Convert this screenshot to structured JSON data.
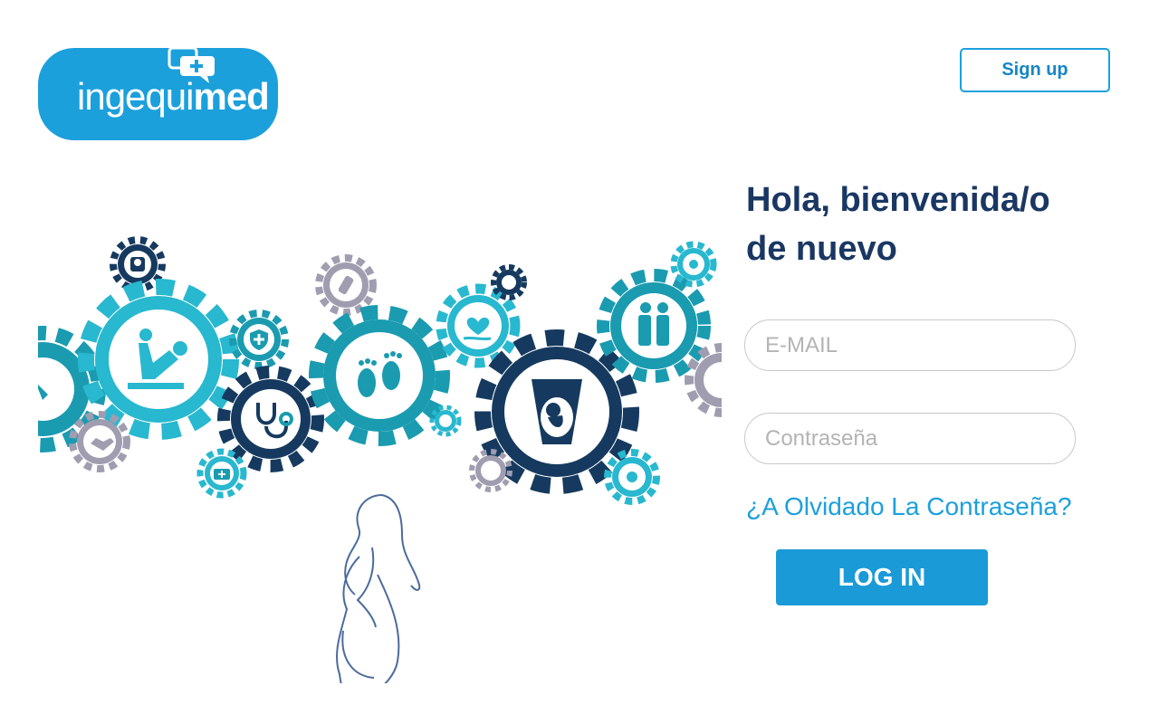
{
  "brand": {
    "logo_light": "ingequi",
    "logo_bold": "med",
    "colors": {
      "primary": "#1ca0dc",
      "dark": "#1a3763",
      "teal": "#1a9bb0",
      "cyan": "#28b8cf",
      "navy": "#163a5f",
      "gray": "#a09db0"
    }
  },
  "header": {
    "signup_label": "Sign up"
  },
  "welcome": {
    "line1": "Hola, bienvenida/o",
    "line2": "de nuevo"
  },
  "form": {
    "email_placeholder": "E-MAIL",
    "password_placeholder": "Contraseña",
    "forgot_label": "¿A Olvidado La Contraseña?",
    "login_label": "LOG IN"
  },
  "hero": {
    "icons": [
      "medical-scale-icon",
      "childbirth-icon",
      "shield-cross-icon",
      "baby-bottle-icon",
      "baby-feet-icon",
      "heart-hand-icon",
      "ultrasound-fetus-icon",
      "family-icon",
      "fetus-icon",
      "stethoscope-icon",
      "handshake-icon",
      "first-aid-kit-icon",
      "pregnant-woman-icon"
    ]
  }
}
